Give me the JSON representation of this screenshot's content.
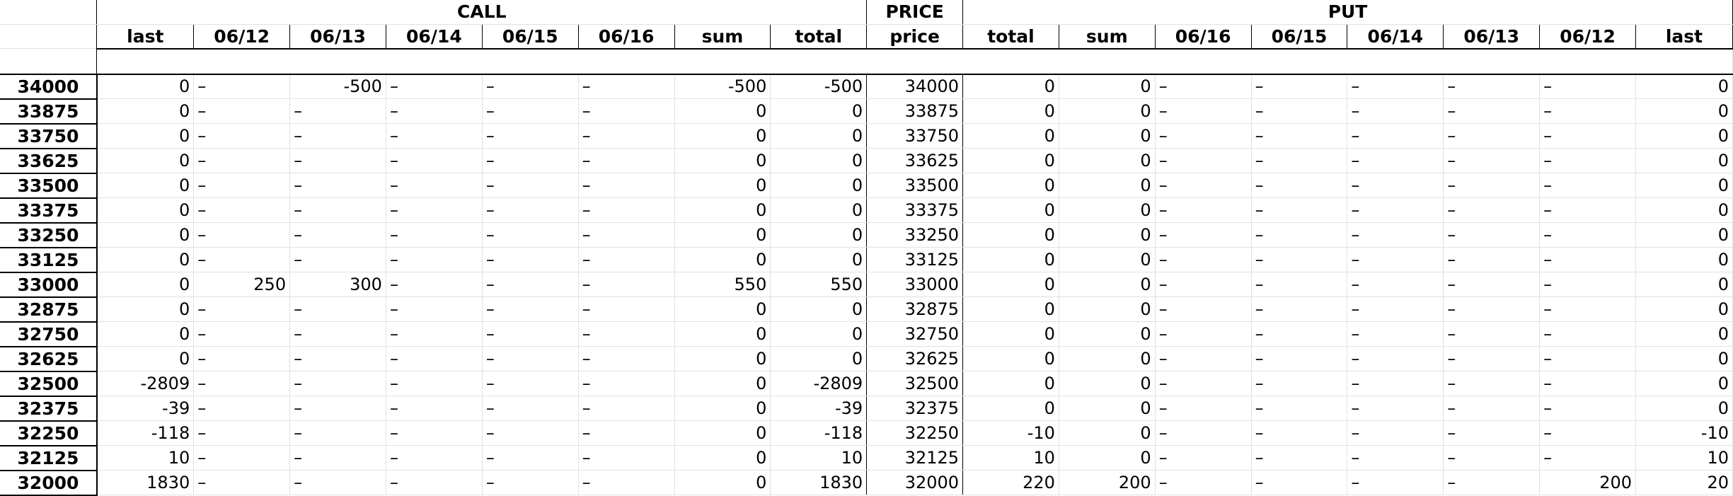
{
  "groups": {
    "call": "CALL",
    "price": "PRICE",
    "put": "PUT"
  },
  "columns": [
    "last",
    "06/12",
    "06/13",
    "06/14",
    "06/15",
    "06/16",
    "sum",
    "total",
    "price",
    "total",
    "sum",
    "06/16",
    "06/15",
    "06/14",
    "06/13",
    "06/12",
    "last"
  ],
  "rows": [
    {
      "label": "34000",
      "cells": [
        "0",
        "–",
        "-500",
        "–",
        "–",
        "–",
        "-500",
        "-500",
        "34000",
        "0",
        "0",
        "–",
        "–",
        "–",
        "–",
        "–",
        "0"
      ]
    },
    {
      "label": "33875",
      "cells": [
        "0",
        "–",
        "–",
        "–",
        "–",
        "–",
        "0",
        "0",
        "33875",
        "0",
        "0",
        "–",
        "–",
        "–",
        "–",
        "–",
        "0"
      ]
    },
    {
      "label": "33750",
      "cells": [
        "0",
        "–",
        "–",
        "–",
        "–",
        "–",
        "0",
        "0",
        "33750",
        "0",
        "0",
        "–",
        "–",
        "–",
        "–",
        "–",
        "0"
      ]
    },
    {
      "label": "33625",
      "cells": [
        "0",
        "–",
        "–",
        "–",
        "–",
        "–",
        "0",
        "0",
        "33625",
        "0",
        "0",
        "–",
        "–",
        "–",
        "–",
        "–",
        "0"
      ]
    },
    {
      "label": "33500",
      "cells": [
        "0",
        "–",
        "–",
        "–",
        "–",
        "–",
        "0",
        "0",
        "33500",
        "0",
        "0",
        "–",
        "–",
        "–",
        "–",
        "–",
        "0"
      ]
    },
    {
      "label": "33375",
      "cells": [
        "0",
        "–",
        "–",
        "–",
        "–",
        "–",
        "0",
        "0",
        "33375",
        "0",
        "0",
        "–",
        "–",
        "–",
        "–",
        "–",
        "0"
      ]
    },
    {
      "label": "33250",
      "cells": [
        "0",
        "–",
        "–",
        "–",
        "–",
        "–",
        "0",
        "0",
        "33250",
        "0",
        "0",
        "–",
        "–",
        "–",
        "–",
        "–",
        "0"
      ]
    },
    {
      "label": "33125",
      "cells": [
        "0",
        "–",
        "–",
        "–",
        "–",
        "–",
        "0",
        "0",
        "33125",
        "0",
        "0",
        "–",
        "–",
        "–",
        "–",
        "–",
        "0"
      ]
    },
    {
      "label": "33000",
      "cells": [
        "0",
        "250",
        "300",
        "–",
        "–",
        "–",
        "550",
        "550",
        "33000",
        "0",
        "0",
        "–",
        "–",
        "–",
        "–",
        "–",
        "0"
      ]
    },
    {
      "label": "32875",
      "cells": [
        "0",
        "–",
        "–",
        "–",
        "–",
        "–",
        "0",
        "0",
        "32875",
        "0",
        "0",
        "–",
        "–",
        "–",
        "–",
        "–",
        "0"
      ]
    },
    {
      "label": "32750",
      "cells": [
        "0",
        "–",
        "–",
        "–",
        "–",
        "–",
        "0",
        "0",
        "32750",
        "0",
        "0",
        "–",
        "–",
        "–",
        "–",
        "–",
        "0"
      ]
    },
    {
      "label": "32625",
      "cells": [
        "0",
        "–",
        "–",
        "–",
        "–",
        "–",
        "0",
        "0",
        "32625",
        "0",
        "0",
        "–",
        "–",
        "–",
        "–",
        "–",
        "0"
      ]
    },
    {
      "label": "32500",
      "cells": [
        "-2809",
        "–",
        "–",
        "–",
        "–",
        "–",
        "0",
        "-2809",
        "32500",
        "0",
        "0",
        "–",
        "–",
        "–",
        "–",
        "–",
        "0"
      ]
    },
    {
      "label": "32375",
      "cells": [
        "-39",
        "–",
        "–",
        "–",
        "–",
        "–",
        "0",
        "-39",
        "32375",
        "0",
        "0",
        "–",
        "–",
        "–",
        "–",
        "–",
        "0"
      ]
    },
    {
      "label": "32250",
      "cells": [
        "-118",
        "–",
        "–",
        "–",
        "–",
        "–",
        "0",
        "-118",
        "32250",
        "-10",
        "0",
        "–",
        "–",
        "–",
        "–",
        "–",
        "-10"
      ]
    },
    {
      "label": "32125",
      "cells": [
        "10",
        "–",
        "–",
        "–",
        "–",
        "–",
        "0",
        "10",
        "32125",
        "10",
        "0",
        "–",
        "–",
        "–",
        "–",
        "–",
        "10"
      ]
    },
    {
      "label": "32000",
      "cells": [
        "1830",
        "–",
        "–",
        "–",
        "–",
        "–",
        "0",
        "1830",
        "32000",
        "220",
        "200",
        "–",
        "–",
        "–",
        "–",
        "200",
        "20"
      ]
    }
  ]
}
